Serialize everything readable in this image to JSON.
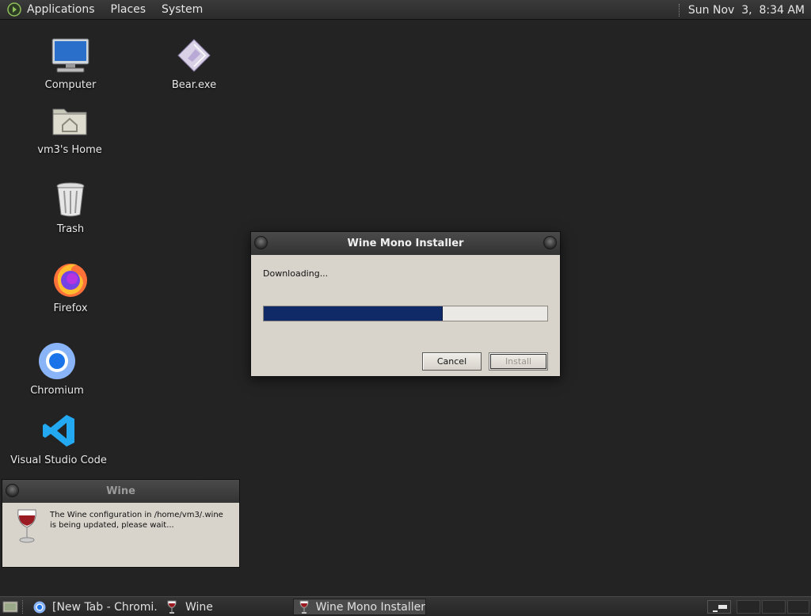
{
  "top_panel": {
    "menus": [
      "Applications",
      "Places",
      "System"
    ],
    "clock": "Sun Nov  3,  8:34 AM"
  },
  "desktop_icons": {
    "computer": "Computer",
    "bear": "Bear.exe",
    "home": "vm3's Home",
    "trash": "Trash",
    "firefox": "Firefox",
    "chromium": "Chromium",
    "vscode": "Visual Studio Code"
  },
  "installer_dialog": {
    "title": "Wine Mono Installer",
    "status": "Downloading...",
    "progress": 0.63,
    "cancel_label": "Cancel",
    "install_label": "Install"
  },
  "wine_notice": {
    "title": "Wine",
    "message": "The Wine configuration in /home/vm3/.wine is being updated, please wait..."
  },
  "taskbar": {
    "tasks": [
      "[New Tab - Chromi...",
      "Wine",
      "Wine Mono Installer"
    ]
  },
  "colors": {
    "desktop_bg": "#232323",
    "progress_fill": "#0f2a66",
    "dialog_bg": "#d8d4cc"
  }
}
